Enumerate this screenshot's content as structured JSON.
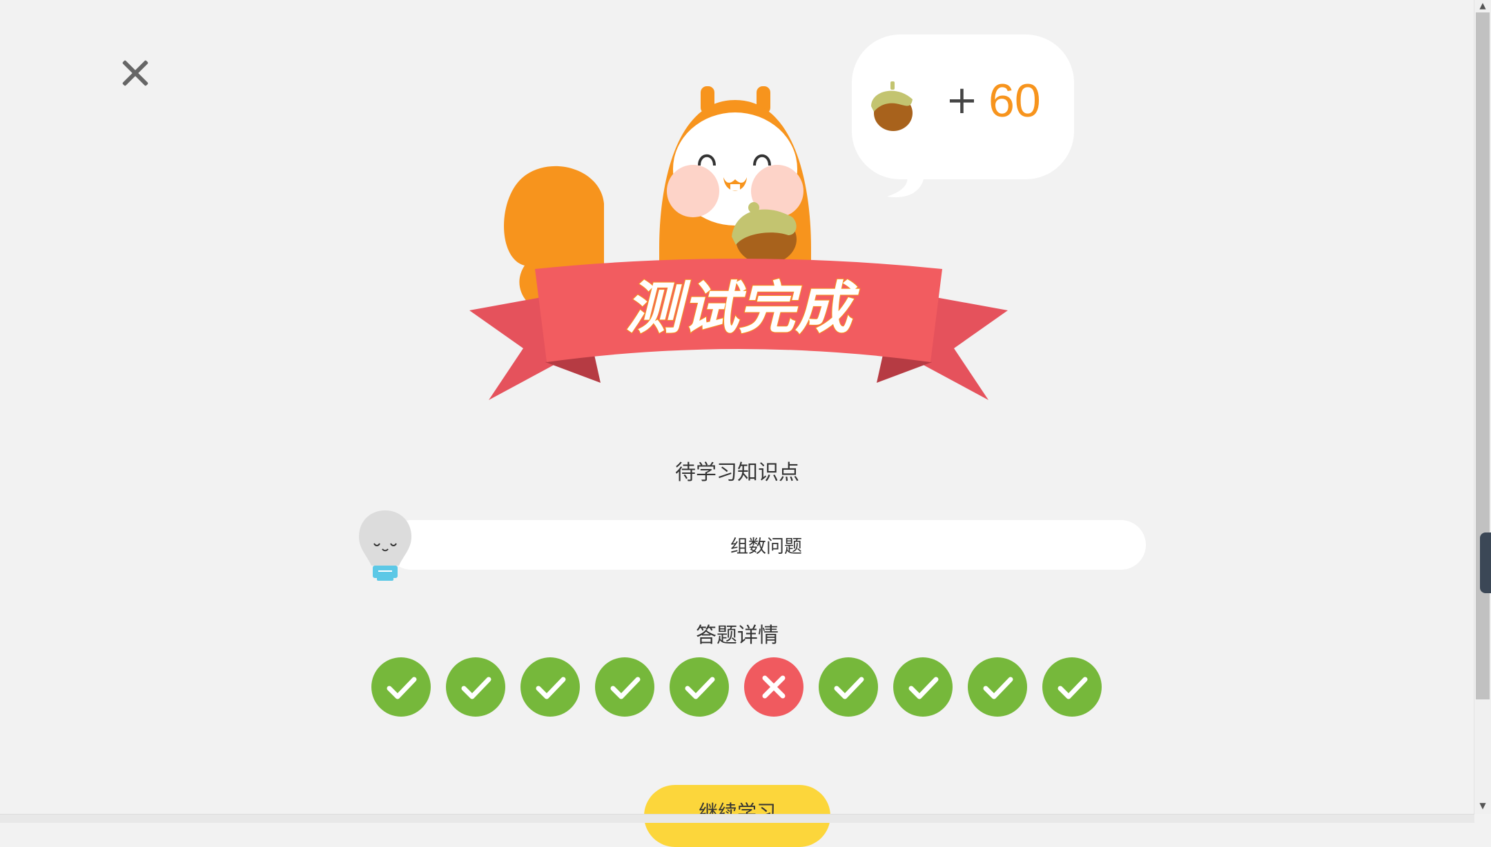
{
  "reward": {
    "plus": "+",
    "value": "60",
    "icon": "acorn-icon"
  },
  "banner": {
    "title": "测试完成"
  },
  "knowledge": {
    "title": "待学习知识点",
    "items": [
      "组数问题"
    ]
  },
  "answers": {
    "title": "答题详情",
    "results": [
      "correct",
      "correct",
      "correct",
      "correct",
      "correct",
      "wrong",
      "correct",
      "correct",
      "correct",
      "correct"
    ]
  },
  "actions": {
    "continue_label": "继续学习",
    "close_icon": "close-icon"
  },
  "colors": {
    "correct": "#76b83b",
    "wrong": "#f05a5f",
    "accent": "#f7941d",
    "button": "#fcd63b"
  }
}
